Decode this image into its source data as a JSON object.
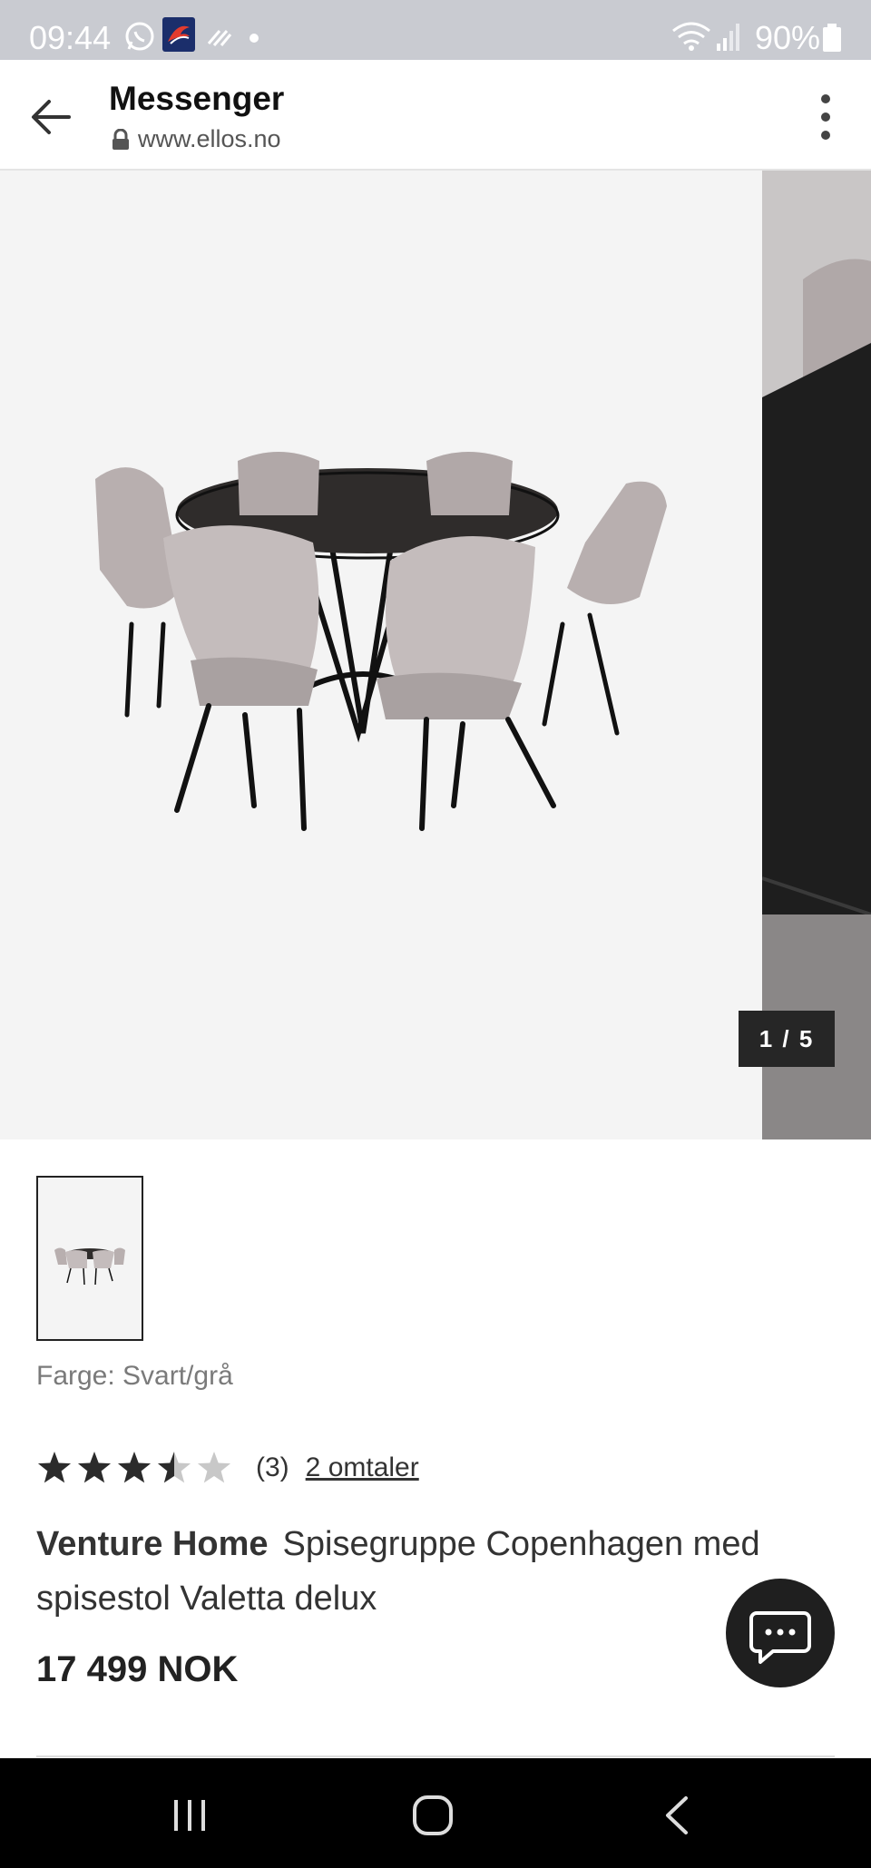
{
  "status_bar": {
    "time": "09:44",
    "battery": "90%"
  },
  "app_bar": {
    "title": "Messenger",
    "url": "www.ellos.no"
  },
  "gallery": {
    "current": "1",
    "separator": "/",
    "total": "5",
    "counter_text": "1 / 5"
  },
  "product": {
    "color_label": "Farge: Svart/grå",
    "rating": {
      "value": 3.5,
      "max": 5,
      "count_text": "(3)",
      "reviews_link": "2 omtaler"
    },
    "brand": "Venture Home",
    "name": "Spisegruppe Copenhagen med spisestol Valetta delux",
    "price": "17 499 NOK"
  },
  "colors": {
    "status_bar_bg": "#c9cbd1",
    "gallery_bg": "#f4f4f4",
    "counter_bg": "#262626",
    "star_filled": "#2b2b2b",
    "star_empty": "#c8c8c8",
    "fab_bg": "#1f1f1f"
  },
  "icons": {
    "status_left": [
      "whatsapp-icon",
      "app-logo-icon",
      "sync-icon",
      "dot-icon"
    ],
    "status_right": [
      "wifi-icon",
      "signal-icon",
      "battery-icon"
    ],
    "app_bar": [
      "back-arrow-icon",
      "lock-icon",
      "more-vert-icon"
    ],
    "fab": "chat-icon",
    "nav": [
      "recents-icon",
      "home-icon",
      "back-icon"
    ]
  }
}
